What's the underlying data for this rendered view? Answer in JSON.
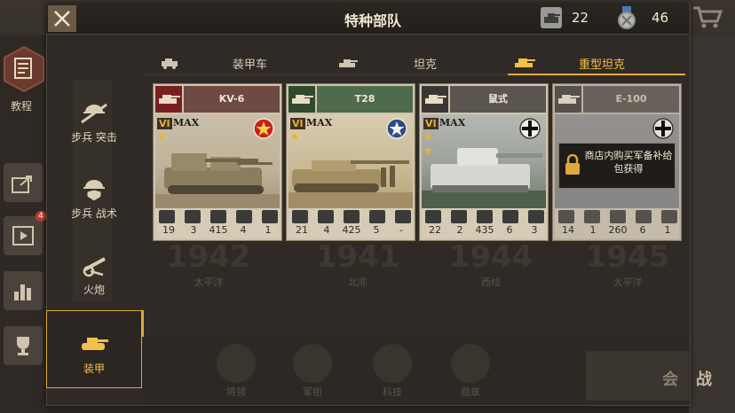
{
  "title": "特种部队",
  "resources": [
    {
      "icon": "tank-token-icon",
      "value": "22"
    },
    {
      "icon": "silver-medal-icon",
      "value": "46"
    }
  ],
  "left_nav": {
    "tutorial_label": "教程",
    "badge": "4"
  },
  "tabs": [
    {
      "label": "装甲车",
      "active": false
    },
    {
      "label": "坦克",
      "active": false
    },
    {
      "label": "重型坦克",
      "active": true
    }
  ],
  "categories": [
    {
      "label": "步兵 突击",
      "icon": "infantry-assault-icon",
      "active": false
    },
    {
      "label": "步兵 战术",
      "icon": "infantry-tactics-icon",
      "active": false
    },
    {
      "label": "火炮",
      "icon": "artillery-icon",
      "active": false
    },
    {
      "label": "装甲",
      "icon": "armor-icon",
      "active": true
    }
  ],
  "stat_icons": [
    "attack-icon",
    "boot-icon",
    "heart-icon",
    "shield-icon",
    "eye-icon"
  ],
  "cards": [
    {
      "name": "KV-6",
      "rank": "VI",
      "max_label": "MAX",
      "stars": 1,
      "header_color": "#6e4a44",
      "insignia": "soviet-star-icon",
      "stats": [
        "19",
        "3",
        "415",
        "4",
        "1"
      ],
      "locked": false
    },
    {
      "name": "T28",
      "rank": "VI",
      "max_label": "MAX",
      "stars": 1,
      "header_color": "#4e6b4c",
      "insignia": "us-star-icon",
      "stats": [
        "21",
        "4",
        "425",
        "5",
        "-"
      ],
      "locked": false
    },
    {
      "name": "鼠式",
      "rank": "VI",
      "max_label": "MAX",
      "stars": 2,
      "header_color": "#5b5550",
      "insignia": "german-cross-icon",
      "stats": [
        "22",
        "2",
        "435",
        "6",
        "3"
      ],
      "locked": false
    },
    {
      "name": "E-100",
      "rank": "",
      "max_label": "",
      "stars": 0,
      "header_color": "#6a625a",
      "insignia": "german-cross-icon",
      "stats": [
        "14",
        "1",
        "260",
        "6",
        "1"
      ],
      "locked": true,
      "lock_text": "商店内购买军备补给包获得"
    }
  ],
  "background_cards": [
    {
      "year": "1942",
      "region": "太平洋"
    },
    {
      "year": "1941",
      "region": "北非"
    },
    {
      "year": "1944",
      "region": "西线"
    },
    {
      "year": "1945",
      "region": "太平洋"
    }
  ],
  "bottom_menu": [
    {
      "label": "将领",
      "icon": "general-cap-icon"
    },
    {
      "label": "军衔",
      "icon": "rank-badge-icon"
    },
    {
      "label": "科技",
      "icon": "gear-icon"
    },
    {
      "label": "勋章",
      "icon": "medal-icon"
    }
  ],
  "battle_button": {
    "left": "会",
    "right": "战"
  }
}
